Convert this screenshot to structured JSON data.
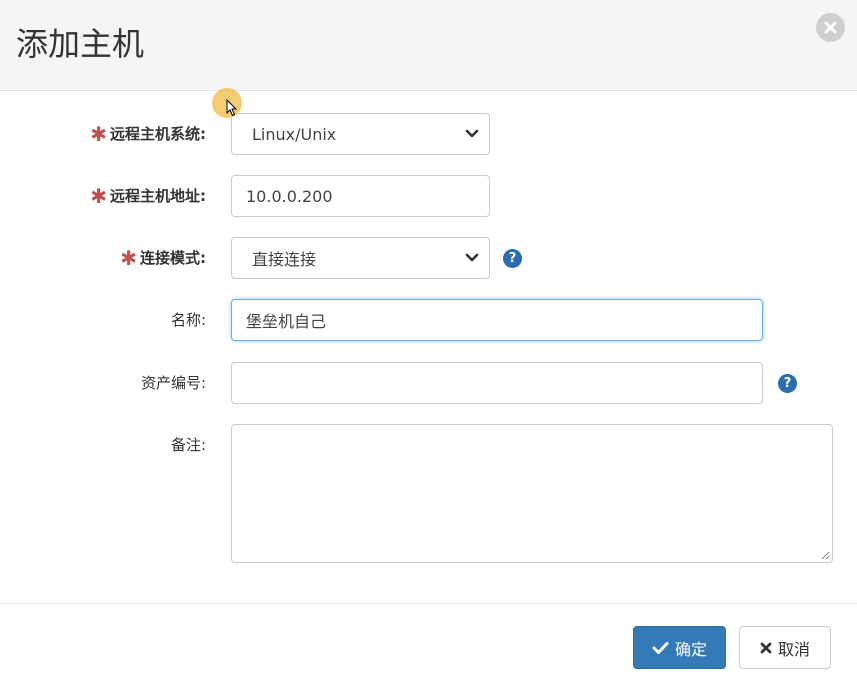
{
  "dialog": {
    "title": "添加主机"
  },
  "form": {
    "os": {
      "label": "远程主机系统:",
      "required": true,
      "value": "Linux/Unix"
    },
    "address": {
      "label": "远程主机地址:",
      "required": true,
      "value": "10.0.0.200"
    },
    "connect_mode": {
      "label": "连接模式:",
      "required": true,
      "value": "直接连接"
    },
    "name": {
      "label": "名称:",
      "value": "堡垒机自己"
    },
    "asset_no": {
      "label": "资产编号:",
      "value": ""
    },
    "remark": {
      "label": "备注:",
      "value": ""
    },
    "required_mark": "✱",
    "help_mark": "?"
  },
  "footer": {
    "confirm_label": "确定",
    "cancel_label": "取消"
  },
  "colors": {
    "primary": "#337ab7",
    "required": "#c0504d",
    "help": "#2a6cb0",
    "focus": "#66afe9"
  },
  "icons": [
    "close-icon",
    "chevron-down-icon",
    "help-icon",
    "check-icon",
    "times-icon",
    "resize-grip-icon"
  ]
}
